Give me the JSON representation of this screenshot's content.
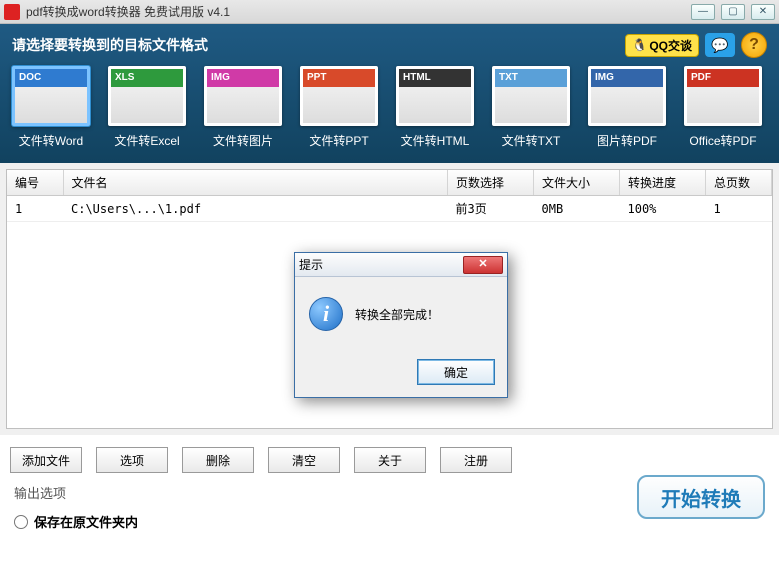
{
  "window": {
    "title": "pdf转换成word转换器 免费试用版 v4.1"
  },
  "toolbar": {
    "heading": "请选择要转换到的目标文件格式",
    "qq_label": "QQ交谈",
    "help_label": "?",
    "formats": [
      {
        "badge": "DOC",
        "label": "文件转Word",
        "color": "#2f7bd0"
      },
      {
        "badge": "XLS",
        "label": "文件转Excel",
        "color": "#2e9a3d"
      },
      {
        "badge": "IMG",
        "label": "文件转图片",
        "color": "#d03aa7"
      },
      {
        "badge": "PPT",
        "label": "文件转PPT",
        "color": "#d84a2a"
      },
      {
        "badge": "HTML",
        "label": "文件转HTML",
        "color": "#333"
      },
      {
        "badge": "TXT",
        "label": "文件转TXT",
        "color": "#5aa0d8"
      },
      {
        "badge": "IMG",
        "label": "图片转PDF",
        "color": "#3366aa"
      },
      {
        "badge": "PDF",
        "label": "Office转PDF",
        "color": "#c32"
      }
    ]
  },
  "table": {
    "headers": {
      "index": "编号",
      "filename": "文件名",
      "pagesel": "页数选择",
      "filesize": "文件大小",
      "progress": "转换进度",
      "totalpages": "总页数"
    },
    "rows": [
      {
        "index": "1",
        "filename": "C:\\Users\\...\\1.pdf",
        "pagesel": "前3页",
        "filesize": "0MB",
        "progress": "100%",
        "totalpages": "1"
      }
    ]
  },
  "buttons": {
    "add": "添加文件",
    "options": "选项",
    "delete": "删除",
    "clear": "清空",
    "about": "关于",
    "register": "注册"
  },
  "output": {
    "section_title": "输出选项",
    "radio_same_folder": "保存在原文件夹内"
  },
  "start_button": "开始转换",
  "dialog": {
    "title": "提示",
    "message": "转换全部完成！",
    "ok": "确定"
  }
}
